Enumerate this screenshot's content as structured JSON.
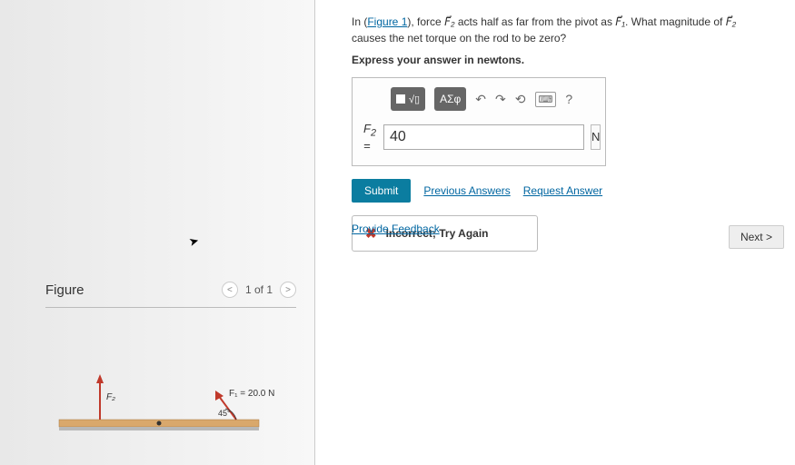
{
  "question": {
    "prefix": "In (",
    "figure_link": "Figure 1",
    "mid1": "), force ",
    "f2": "F⃗₂",
    "mid2": " acts half as far from the pivot as ",
    "f1": "F⃗₁",
    "mid3": ". What magnitude of ",
    "f2b": "F⃗₂",
    "tail": " causes the net torque on the rod to be zero?",
    "instruction": "Express your answer in newtons."
  },
  "toolbar": {
    "templates_label": "ΑΣφ",
    "undo_tip": "undo",
    "redo_tip": "redo",
    "reset_tip": "reset",
    "keyboard_tip": "keyboard",
    "help_tip": "?"
  },
  "answer": {
    "label_html": "F₂ =",
    "value": "40",
    "unit": "N"
  },
  "actions": {
    "submit": "Submit",
    "previous": "Previous Answers",
    "request": "Request Answer"
  },
  "feedback": {
    "message": "Incorrect; Try Again"
  },
  "provide_feedback": "Provide Feedback",
  "next": "Next",
  "figure": {
    "title": "Figure",
    "pager": "1 of 1",
    "f1_label": "F₁ = 20.0 N",
    "angle_label": "45°",
    "f2_arrow_label": "F₂"
  }
}
